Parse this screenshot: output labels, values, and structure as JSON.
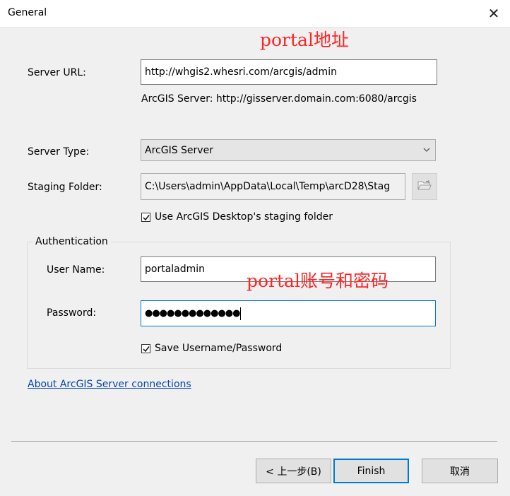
{
  "window": {
    "title": "General",
    "close_glyph": "✕"
  },
  "annotations": {
    "portal_address": "portal地址",
    "portal_account": "portal账号和密码"
  },
  "server_url": {
    "label": "Server URL:",
    "value": "http://whgis2.whesri.com/arcgis/admin",
    "hint": "ArcGIS Server: http://gisserver.domain.com:6080/arcgis"
  },
  "server_type": {
    "label": "Server Type:",
    "selected": "ArcGIS Server"
  },
  "staging_folder": {
    "label": "Staging Folder:",
    "value": "C:\\Users\\admin\\AppData\\Local\\Temp\\arcD28\\Stag",
    "use_desktop_label": "Use ArcGIS Desktop's staging folder",
    "use_desktop_checked": true
  },
  "authentication": {
    "title": "Authentication",
    "username_label": "User Name:",
    "username_value": "portaladmin",
    "password_label": "Password:",
    "password_mask": "●●●●●●●●●●●●●",
    "save_label": "Save Username/Password",
    "save_checked": true
  },
  "about_link": "About ArcGIS Server connections",
  "buttons": {
    "back": "< 上一步(B)",
    "finish": "Finish",
    "cancel": "取消"
  },
  "icons": {
    "close": "close-icon",
    "dropdown": "chevron-down-icon",
    "folder": "folder-open-icon",
    "check": "checkmark-icon"
  }
}
